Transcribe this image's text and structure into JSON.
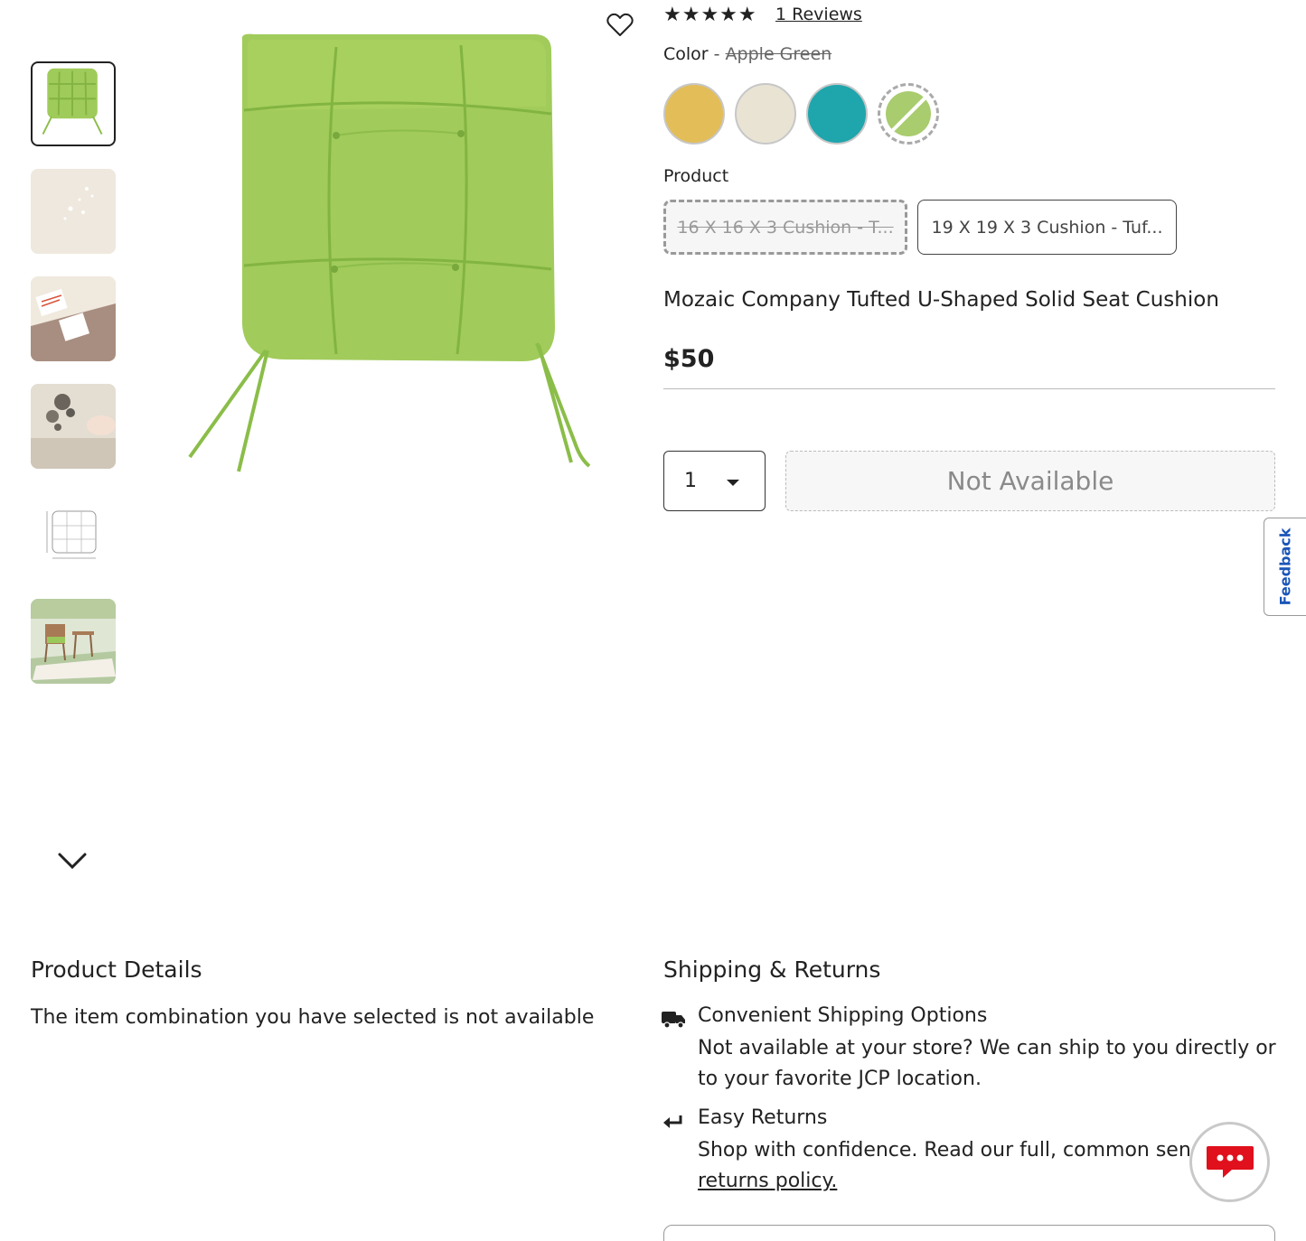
{
  "gallery": {
    "thumbnails": [
      "green-cushion-thumb",
      "fabric-water-thumb",
      "label-tags-thumb",
      "stain-cleaning-thumb",
      "dimension-drawing-thumb",
      "patio-scene-thumb"
    ]
  },
  "rating": {
    "stars": "★★★★★",
    "reviews": "1 Reviews"
  },
  "color": {
    "label": "Color",
    "separator": " - ",
    "selected": "Apple Green",
    "swatches": [
      "#e3bd58",
      "#e9e3d4",
      "#1fa5ac",
      "#a9cc6e"
    ]
  },
  "product_option": {
    "label": "Product",
    "options": [
      "16 X 16 X 3 Cushion - T...",
      "19 X 19 X 3 Cushion - Tuf..."
    ]
  },
  "title": "Mozaic Company Tufted U-Shaped Solid Seat Cushion",
  "price": "$50",
  "quantity": "1",
  "add_button": "Not Available",
  "feedback": "Feedback",
  "details": {
    "heading": "Product Details",
    "text": "The item combination you have selected is not available"
  },
  "shipping": {
    "heading": "Shipping & Returns",
    "shipping_title": "Convenient Shipping Options",
    "shipping_text": "Not available at your store? We can ship to you directly or to your favorite JCP location.",
    "returns_title": "Easy Returns",
    "returns_text": "Shop with confidence. Read our full, common sense ",
    "returns_link": "returns policy."
  },
  "colors": {
    "text": "#222222",
    "feedback": "#1a55b8",
    "chat": "#e0101c"
  }
}
